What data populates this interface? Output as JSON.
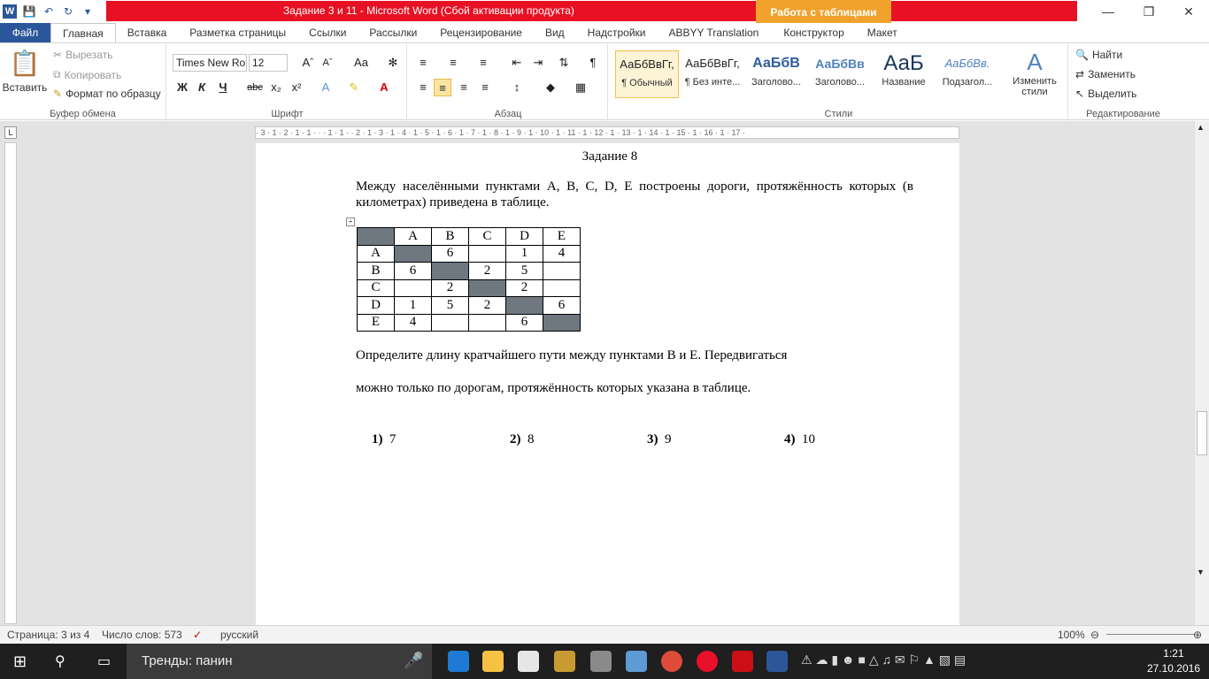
{
  "window": {
    "title": "Задание 3 и 11  -  Microsoft Word (Сбой активации продукта)",
    "context_tab": "Работа с таблицами"
  },
  "tabs": [
    "Файл",
    "Главная",
    "Вставка",
    "Разметка страницы",
    "Ссылки",
    "Рассылки",
    "Рецензирование",
    "Вид",
    "Надстройки",
    "ABBYY Translation",
    "Конструктор",
    "Макет"
  ],
  "ribbon": {
    "clipboard": {
      "paste": "Вставить",
      "cut": "Вырезать",
      "copy": "Копировать",
      "format_painter": "Формат по образцу",
      "label": "Буфер обмена"
    },
    "font": {
      "name": "Times New Ro",
      "size": "12",
      "label": "Шрифт"
    },
    "paragraph": {
      "label": "Абзац"
    },
    "styles": {
      "label": "Стили",
      "items": [
        {
          "preview": "АаБбВвГг,",
          "name": "¶ Обычный"
        },
        {
          "preview": "АаБбВвГг,",
          "name": "¶ Без инте..."
        },
        {
          "preview": "АаБбВ",
          "name": "Заголово..."
        },
        {
          "preview": "АаБбВв",
          "name": "Заголово..."
        },
        {
          "preview": "АаБ",
          "name": "Название"
        },
        {
          "preview": "АаБбВв.",
          "name": "Подзагол..."
        }
      ],
      "change_styles": "Изменить стили"
    },
    "editing": {
      "find": "Найти",
      "replace": "Заменить",
      "select": "Выделить",
      "label": "Редактирование"
    }
  },
  "document": {
    "heading": "Задание 8",
    "intro": "Между населёнными пунктами A, B, C, D, E построены дороги, протяжённость которых (в километрах) приведена в таблице.",
    "table": {
      "headers": [
        "",
        "A",
        "B",
        "C",
        "D",
        "E"
      ],
      "rows": [
        [
          "A",
          "",
          "6",
          "",
          "1",
          "4"
        ],
        [
          "B",
          "6",
          "",
          "2",
          "5",
          ""
        ],
        [
          "C",
          "",
          "2",
          "",
          "2",
          ""
        ],
        [
          "D",
          "1",
          "5",
          "2",
          "",
          "6"
        ],
        [
          "E",
          "4",
          "",
          "",
          "6",
          ""
        ]
      ]
    },
    "question_line1": "Определите длину кратчайшего пути между пунктами B и E. Передвигаться",
    "question_line2": "можно только по дорогам, протяжённость которых указана в таблице.",
    "answers": [
      {
        "num": "1)",
        "val": "7"
      },
      {
        "num": "2)",
        "val": "8"
      },
      {
        "num": "3)",
        "val": "9"
      },
      {
        "num": "4)",
        "val": "10"
      }
    ]
  },
  "status": {
    "page": "Страница: 3 из 4",
    "words": "Число слов: 573",
    "lang": "русский",
    "zoom": "100%"
  },
  "taskbar": {
    "search": "Тренды: панин",
    "time": "1:21",
    "date": "27.10.2016"
  }
}
